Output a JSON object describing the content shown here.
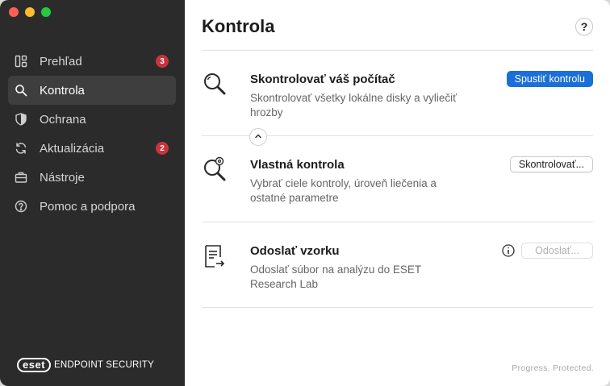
{
  "sidebar": {
    "items": [
      {
        "label": "Prehľad",
        "icon": "dashboard-icon",
        "badge": "3"
      },
      {
        "label": "Kontrola",
        "icon": "search-icon",
        "active": true
      },
      {
        "label": "Ochrana",
        "icon": "shield-icon"
      },
      {
        "label": "Aktualizácia",
        "icon": "refresh-icon",
        "badge": "2"
      },
      {
        "label": "Nástroje",
        "icon": "toolbox-icon"
      },
      {
        "label": "Pomoc a podpora",
        "icon": "help-circle-icon"
      }
    ],
    "logo": {
      "mark": "eset",
      "product": "ENDPOINT SECURITY"
    }
  },
  "main": {
    "title": "Kontrola",
    "help_label": "?",
    "rows": [
      {
        "title": "Skontrolovať váš počítač",
        "description": "Skontrolovať všetky lokálne disky a vyliečiť hrozby",
        "button": "Spustiť kontrolu",
        "icon": "magnifier-icon"
      },
      {
        "title": "Vlastná kontrola",
        "description": "Vybrať ciele kontroly, úroveň liečenia a ostatné parametre",
        "button": "Skontrolovať...",
        "icon": "custom-scan-icon"
      },
      {
        "title": "Odoslať vzorku",
        "description": "Odoslať súbor na analýzu do ESET Research Lab",
        "button": "Odoslať...",
        "icon": "submit-sample-icon"
      }
    ],
    "tagline": "Progress. Protected."
  },
  "colors": {
    "sidebar_bg": "#2b2b2c",
    "accent": "#1a6fd8",
    "badge": "#c9343a"
  }
}
